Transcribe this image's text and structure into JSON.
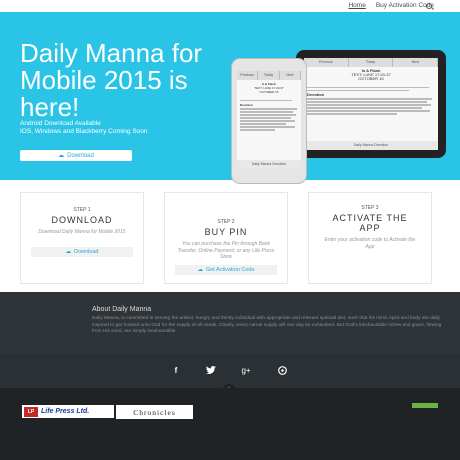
{
  "nav": {
    "items": [
      "Home",
      "Buy Activation Code"
    ]
  },
  "hero": {
    "title": "Daily Manna for Mobile 2015 is here!",
    "line1": "Android Download Available",
    "line2": "IOS, Windows and Blackberry Coming Soon",
    "download_label": "Download"
  },
  "phone": {
    "tabs": [
      "Previous",
      "Today",
      "Next"
    ],
    "heading": "It & Flash",
    "sub": "TEXT: LUKE 17:20-37",
    "date": "OCTOBER 15",
    "section": "Devotion",
    "footer": "Daily Manna Devotion"
  },
  "tablet": {
    "tabs": [
      "Previous",
      "Today",
      "Next"
    ],
    "heading": "In A Flash",
    "sub": "TEXT: LUKE 17:20-37",
    "date": "OCTOBER 15",
    "section": "Devotion",
    "footer": "Daily Manna Devotion"
  },
  "steps": [
    {
      "label": "STEP 1",
      "heading": "DOWNLOAD",
      "desc": "Download Daily Manna for Mobile 2015",
      "button": "Download"
    },
    {
      "label": "STEP 2",
      "heading": "BUY PIN",
      "desc": "You can purchase the Pin through Bank Transfer, Online Payment, or any Life Press Store",
      "button": "Get Activation Code"
    },
    {
      "label": "STEP 3",
      "heading": "ACTIVATE THE APP",
      "desc": "Enter your activation code to Activate the App"
    }
  ],
  "about": {
    "title": "About Daily Manna",
    "text": "Daily Manna, is committed in serving the ardent, hungry and thirsty individual with appropriate and relevant spiritual diet, such that his mind, spirit and body are daily inspired to get hooked unto God for the supply of all needs. Clearly, every carnal supply will one day be exhausted. But God's inexhaustible riches and grace, flowing from His word, are simply inexhaustible."
  },
  "social": [
    "f",
    "twitter",
    "g+",
    "github"
  ],
  "footer": {
    "logo1_mark": "LP",
    "logo1_name": "Life Press Ltd.",
    "logo2_name": "Chronicles"
  },
  "colors": {
    "hero": "#29c4e6",
    "dark": "#2f3438",
    "footer": "#1f2326",
    "accent": "#29a8d8"
  }
}
